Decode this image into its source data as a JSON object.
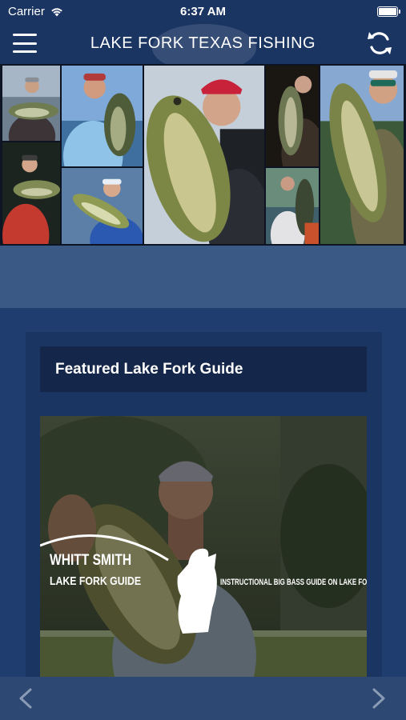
{
  "status_bar": {
    "carrier": "Carrier",
    "time": "6:37 AM"
  },
  "nav": {
    "title": "LAKE FORK TEXAS FISHING",
    "menu_icon": "hamburger-menu-icon",
    "refresh_icon": "refresh-icon"
  },
  "featured": {
    "heading": "Featured Lake Fork Guide",
    "guide_name": "WHITT SMITH",
    "guide_role": "LAKE FORK GUIDE",
    "tagline": "INSTRUCTIONAL BIG BASS GUIDE ON LAKE FORK"
  },
  "pager": {
    "prev_icon": "chevron-left-icon",
    "next_icon": "chevron-right-icon"
  },
  "colors": {
    "nav_bg": "#1b3563",
    "page_bg": "#1f3d6e",
    "band": "#3a5a85",
    "header_dark": "#14274a"
  }
}
